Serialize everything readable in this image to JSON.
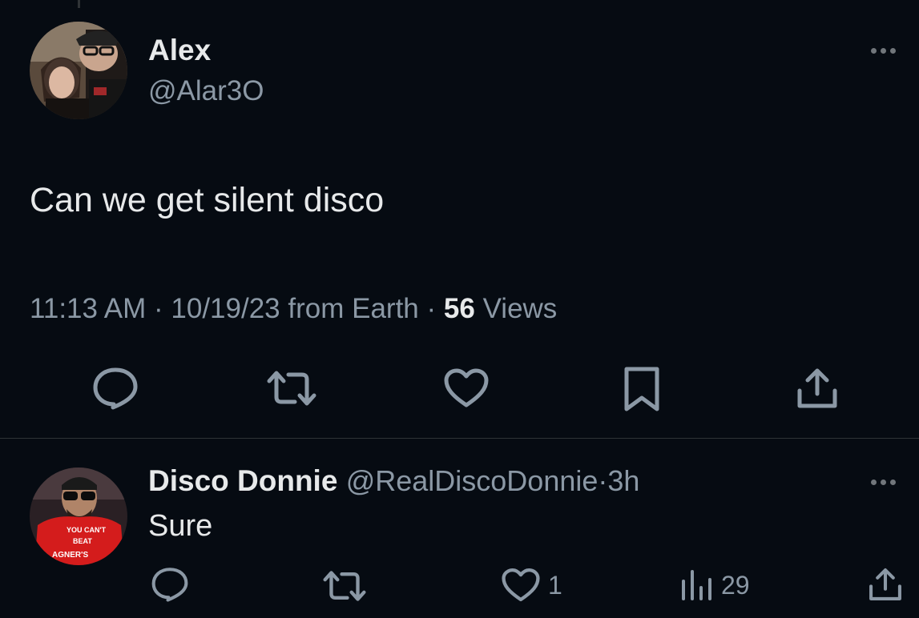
{
  "tweet": {
    "author_name": "Alex",
    "author_handle": "@Alar3O",
    "text": "Can we get silent disco",
    "time": "11:13 AM",
    "separator": "·",
    "date": "10/19/23",
    "source": "from Earth",
    "views_count": "56",
    "views_label": "Views"
  },
  "reply": {
    "author_name": "Disco Donnie",
    "author_handle": "@RealDiscoDonnie",
    "separator": "·",
    "age": "3h",
    "text": "Sure",
    "like_count": "1",
    "view_count": "29",
    "avatar_shirt_text": [
      "YOU CAN'T",
      "BEAT",
      "AGNER'S"
    ]
  },
  "colors": {
    "background": "#060b12",
    "text": "#e7e9ea",
    "secondary": "#8b98a5",
    "divider": "#2f3336"
  },
  "icons": {
    "reply": "reply-icon",
    "retweet": "retweet-icon",
    "like": "heart-icon",
    "bookmark": "bookmark-icon",
    "share": "share-icon",
    "views": "views-chart-icon",
    "more": "more-icon"
  }
}
